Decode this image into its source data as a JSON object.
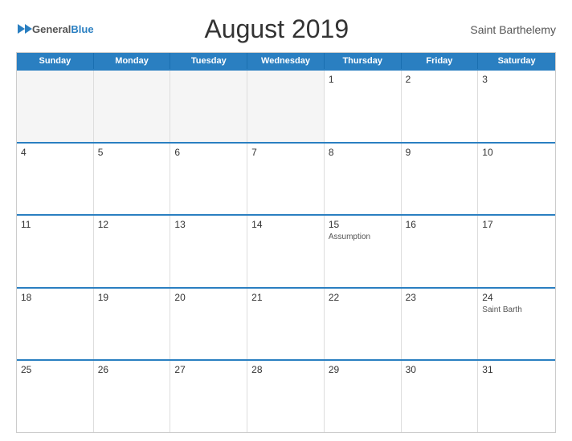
{
  "header": {
    "logo_general": "General",
    "logo_blue": "Blue",
    "title": "August 2019",
    "region": "Saint Barthelemy"
  },
  "weekdays": [
    "Sunday",
    "Monday",
    "Tuesday",
    "Wednesday",
    "Thursday",
    "Friday",
    "Saturday"
  ],
  "weeks": [
    [
      {
        "day": "",
        "event": "",
        "empty": true
      },
      {
        "day": "",
        "event": "",
        "empty": true
      },
      {
        "day": "",
        "event": "",
        "empty": true
      },
      {
        "day": "",
        "event": "",
        "empty": true
      },
      {
        "day": "1",
        "event": ""
      },
      {
        "day": "2",
        "event": ""
      },
      {
        "day": "3",
        "event": ""
      }
    ],
    [
      {
        "day": "4",
        "event": ""
      },
      {
        "day": "5",
        "event": ""
      },
      {
        "day": "6",
        "event": ""
      },
      {
        "day": "7",
        "event": ""
      },
      {
        "day": "8",
        "event": ""
      },
      {
        "day": "9",
        "event": ""
      },
      {
        "day": "10",
        "event": ""
      }
    ],
    [
      {
        "day": "11",
        "event": ""
      },
      {
        "day": "12",
        "event": ""
      },
      {
        "day": "13",
        "event": ""
      },
      {
        "day": "14",
        "event": ""
      },
      {
        "day": "15",
        "event": "Assumption"
      },
      {
        "day": "16",
        "event": ""
      },
      {
        "day": "17",
        "event": ""
      }
    ],
    [
      {
        "day": "18",
        "event": ""
      },
      {
        "day": "19",
        "event": ""
      },
      {
        "day": "20",
        "event": ""
      },
      {
        "day": "21",
        "event": ""
      },
      {
        "day": "22",
        "event": ""
      },
      {
        "day": "23",
        "event": ""
      },
      {
        "day": "24",
        "event": "Saint Barth"
      }
    ],
    [
      {
        "day": "25",
        "event": ""
      },
      {
        "day": "26",
        "event": ""
      },
      {
        "day": "27",
        "event": ""
      },
      {
        "day": "28",
        "event": ""
      },
      {
        "day": "29",
        "event": ""
      },
      {
        "day": "30",
        "event": ""
      },
      {
        "day": "31",
        "event": ""
      }
    ]
  ]
}
